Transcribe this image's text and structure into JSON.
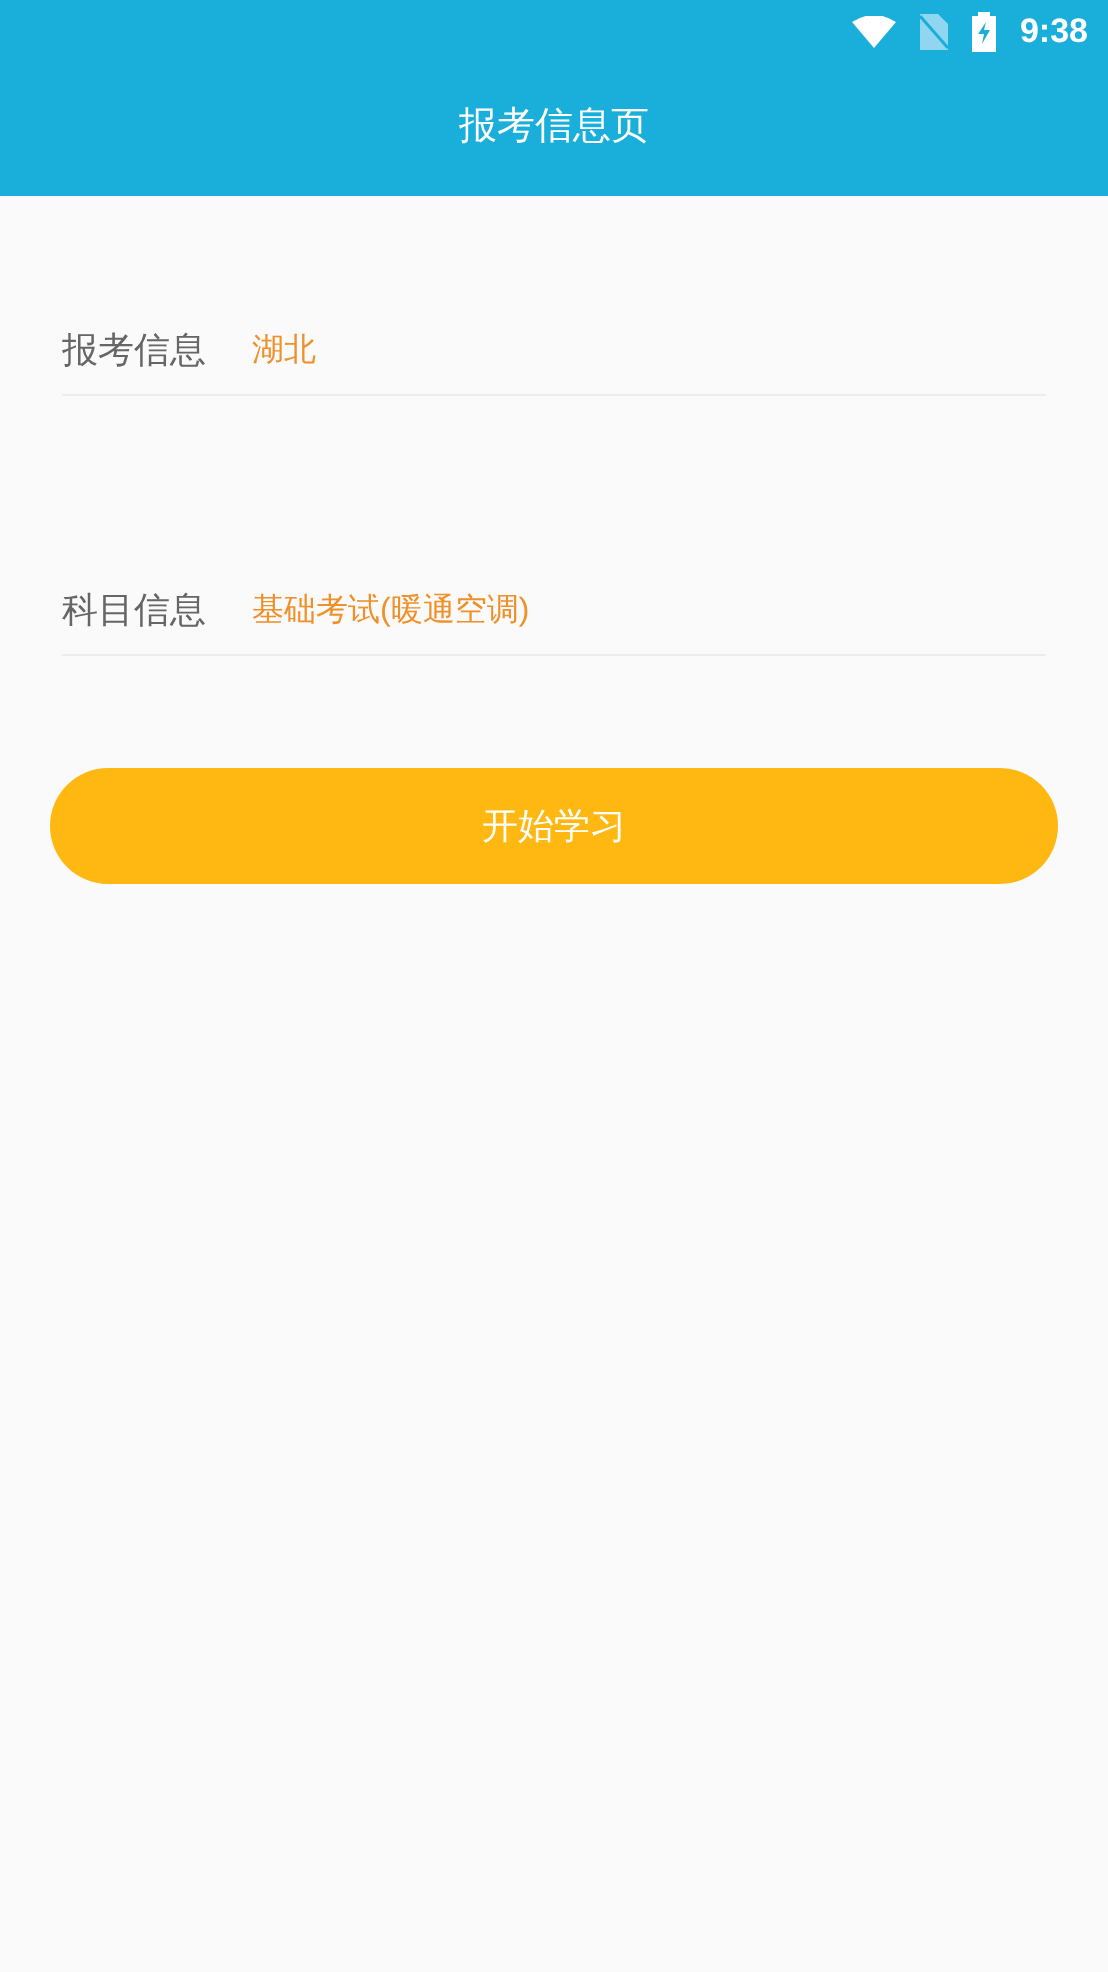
{
  "status_bar": {
    "time": "9:38"
  },
  "header": {
    "title": "报考信息页"
  },
  "fields": [
    {
      "label": "报考信息",
      "value": "湖北"
    },
    {
      "label": "科目信息",
      "value": "基础考试(暖通空调)"
    }
  ],
  "button": {
    "label": "开始学习"
  }
}
